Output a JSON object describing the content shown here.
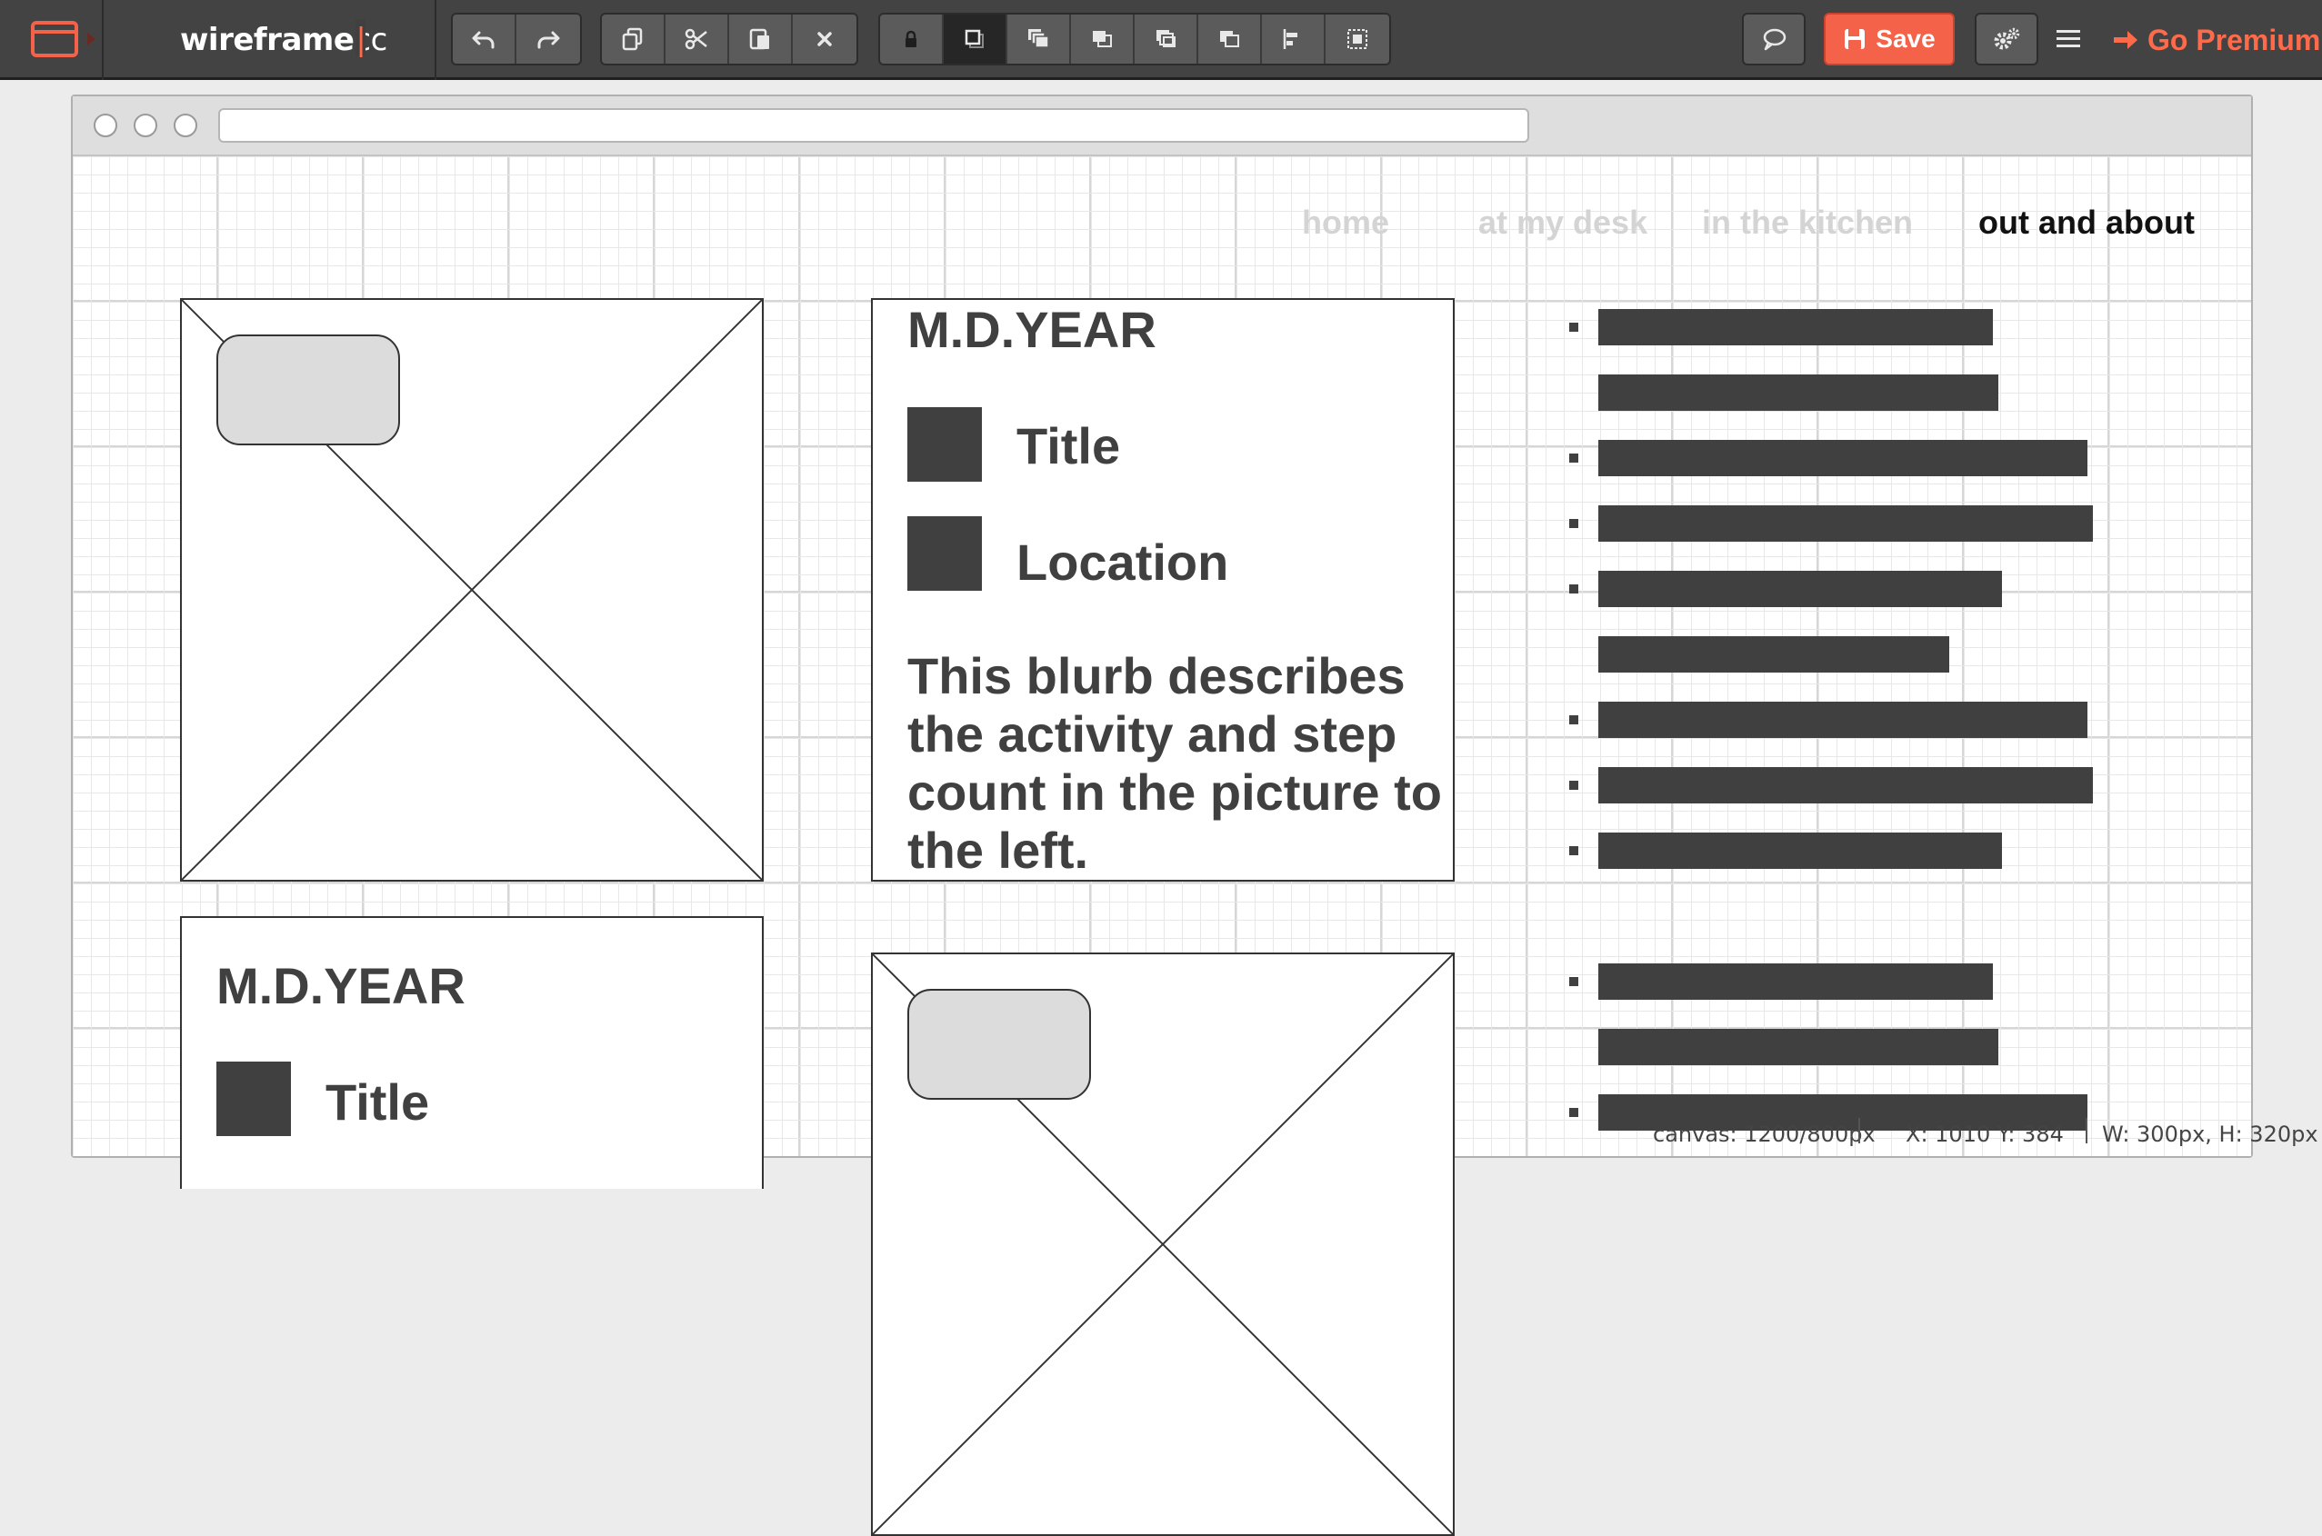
{
  "app": {
    "brand_main": "wireframe",
    "brand_sep": "|",
    "brand_suffix": "cc",
    "save_label": "Save",
    "premium_label": "Go Premium",
    "accent_color": "#f4624a"
  },
  "toolbar": {
    "history": [
      "undo-icon",
      "redo-icon"
    ],
    "clipboard": [
      "duplicate-icon",
      "cut-icon",
      "paste-icon",
      "delete-icon"
    ],
    "arrange": [
      "lock-icon",
      "layer-bring-front-icon",
      "layer-stack-icon",
      "layer-bring-forward-icon",
      "layer-send-backward-icon",
      "layer-send-back-icon",
      "align-icon",
      "group-select-icon"
    ],
    "arrange_active": "layer-bring-front-icon",
    "right": [
      "comment-icon",
      "settings-icon",
      "menu-icon"
    ]
  },
  "page": {
    "nav": [
      "home",
      "at my desk",
      "in the kitchen",
      "out and about"
    ],
    "nav_active": "out and about",
    "card1": {
      "date": "M.D.YEAR",
      "title": "Title",
      "location": "Location",
      "blurb": "This blurb describes the activity and step count in the picture to the left."
    },
    "card2": {
      "date": "M.D.YEAR",
      "title": "Title"
    }
  },
  "status": {
    "canvas": "canvas: 1200/800px",
    "cursor": "X: 1010 Y: 384",
    "size": "W: 300px, H: 320px"
  }
}
